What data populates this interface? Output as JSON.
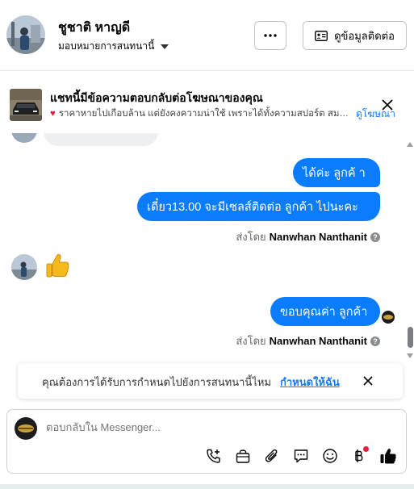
{
  "header": {
    "name": "ชูชาติ หาญดี",
    "subtitle": "มอบหมายการสนทนานี้",
    "contact_button": "ดูข้อมูลติดต่อ"
  },
  "ad_banner": {
    "title": "แชทนี้มีข้อความตอบกลับต่อโฆษณาของคุณ",
    "description": "ราคาหายไปเกือบล้าน แต่ยังคงความน่าใช้ เพราะได้ทั้งความสปอร์ต สมร...",
    "link": "ดูโฆษณา"
  },
  "messages": {
    "m1": "ได้ค่ะ  ลูกค้ า",
    "m2": "เดี๋ยว13.00 จะมีเซลส์ติดต่อ ลูกค้า  ไปนะคะ",
    "m3": "ขอบคุณค่า ลูกค้า",
    "sent_by_prefix": "ส่งโดย",
    "sent_by_name": "Nanwhan Nanthanit"
  },
  "prompt": {
    "text": "คุณต้องการได้รับการกำหนดไปยังการสนทนานี้ไหม",
    "link": "กำหนดให้ฉัน"
  },
  "composer": {
    "placeholder": "ตอบกลับใน Messenger..."
  },
  "colors": {
    "bubble": "#0a7cff",
    "link": "#1877f2",
    "badge": "#e41e3f"
  }
}
